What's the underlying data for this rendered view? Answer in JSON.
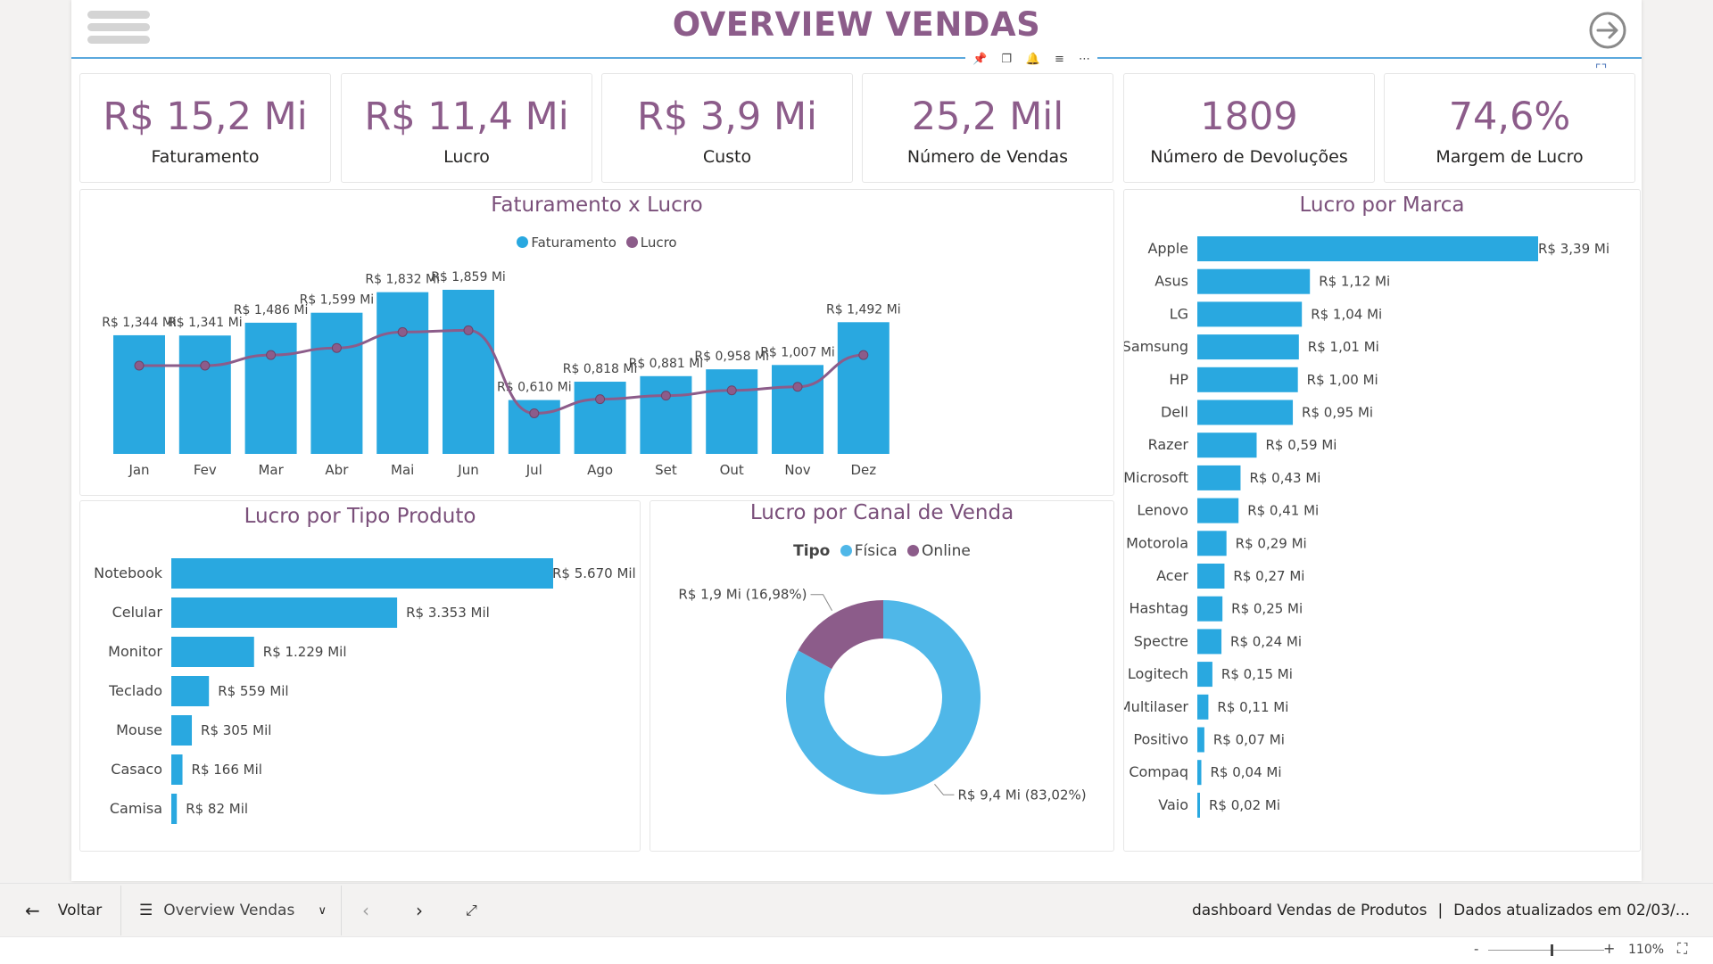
{
  "header": {
    "title": "OVERVIEW VENDAS"
  },
  "visual_toolbar": {
    "icons": [
      "pin-icon",
      "copy-icon",
      "bell-icon",
      "filter-icon",
      "more-options-icon"
    ]
  },
  "kpis": [
    {
      "value": "R$ 15,2 Mi",
      "label": "Faturamento"
    },
    {
      "value": "R$ 11,4 Mi",
      "label": "Lucro"
    },
    {
      "value": "R$ 3,9 Mi",
      "label": "Custo"
    },
    {
      "value": "25,2 Mil",
      "label": "Número de Vendas"
    },
    {
      "value": "1809",
      "label": "Número de Devoluções"
    },
    {
      "value": "74,6%",
      "label": "Margem de Lucro"
    }
  ],
  "colors": {
    "accent_blue": "#29a8e0",
    "accent_purple": "#8c5c8a",
    "donut_blue": "#4fb7e8"
  },
  "chart_data": [
    {
      "type": "bar",
      "title": "Faturamento x Lucro",
      "legend": [
        "Faturamento",
        "Lucro"
      ],
      "legend_position": "top-center",
      "categories": [
        "Jan",
        "Fev",
        "Mar",
        "Abr",
        "Mai",
        "Jun",
        "Jul",
        "Ago",
        "Set",
        "Out",
        "Nov",
        "Dez"
      ],
      "series": [
        {
          "name": "Faturamento",
          "type": "bar",
          "values": [
            1.344,
            1.341,
            1.486,
            1.599,
            1.832,
            1.859,
            0.61,
            0.818,
            0.881,
            0.958,
            1.007,
            1.492
          ]
        },
        {
          "name": "Lucro",
          "type": "line",
          "values": [
            1.0,
            1.0,
            1.12,
            1.2,
            1.38,
            1.4,
            0.46,
            0.62,
            0.66,
            0.72,
            0.76,
            1.12
          ]
        }
      ],
      "data_labels": [
        "R$ 1,344 Mi",
        "R$ 1,341 Mi",
        "R$ 1,486 Mi",
        "R$ 1,599 Mi",
        "R$ 1,832 Mi",
        "R$ 1,859 Mi",
        "R$ 0,610 Mi",
        "R$ 0,818 Mi",
        "R$ 0,881 Mi",
        "R$ 0,958 Mi",
        "R$ 1,007 Mi",
        "R$ 1,492 Mi"
      ],
      "ylim": [
        0,
        2.0
      ],
      "grid": false
    },
    {
      "type": "bar",
      "orientation": "horizontal",
      "title": "Lucro por Tipo Produto",
      "categories": [
        "Notebook",
        "Celular",
        "Monitor",
        "Teclado",
        "Mouse",
        "Casaco",
        "Camisa"
      ],
      "values": [
        5670,
        3353,
        1229,
        559,
        305,
        166,
        82
      ],
      "data_labels": [
        "R$ 5.670 Mil",
        "R$ 3.353 Mil",
        "R$ 1.229 Mil",
        "R$ 559 Mil",
        "R$ 305 Mil",
        "R$ 166 Mil",
        "R$ 82 Mil"
      ],
      "xlim": [
        0,
        5670
      ]
    },
    {
      "type": "pie",
      "donut": true,
      "title": "Lucro por Canal de Venda",
      "legend_title": "Tipo",
      "legend_position": "top-center",
      "categories": [
        "Física",
        "Online"
      ],
      "values": [
        83.02,
        16.98
      ],
      "data_labels": [
        "R$ 9,4 Mi (83,02%)",
        "R$ 1,9 Mi (16,98%)"
      ]
    },
    {
      "type": "bar",
      "orientation": "horizontal",
      "title": "Lucro por Marca",
      "categories": [
        "Apple",
        "Asus",
        "LG",
        "Samsung",
        "HP",
        "Dell",
        "Razer",
        "Microsoft",
        "Lenovo",
        "Motorola",
        "Acer",
        "Hashtag",
        "Spectre",
        "Logitech",
        "Multilaser",
        "Positivo",
        "Compaq",
        "Vaio"
      ],
      "values": [
        3.39,
        1.12,
        1.04,
        1.01,
        1.0,
        0.95,
        0.59,
        0.43,
        0.41,
        0.29,
        0.27,
        0.25,
        0.24,
        0.15,
        0.11,
        0.07,
        0.04,
        0.02
      ],
      "data_labels": [
        "R$ 3,39 Mi",
        "R$ 1,12 Mi",
        "R$ 1,04 Mi",
        "R$ 1,01 Mi",
        "R$ 1,00 Mi",
        "R$ 0,95 Mi",
        "R$ 0,59 Mi",
        "R$ 0,43 Mi",
        "R$ 0,41 Mi",
        "R$ 0,29 Mi",
        "R$ 0,27 Mi",
        "R$ 0,25 Mi",
        "R$ 0,24 Mi",
        "R$ 0,15 Mi",
        "R$ 0,11 Mi",
        "R$ 0,07 Mi",
        "R$ 0,04 Mi",
        "R$ 0,02 Mi"
      ],
      "xlim": [
        0,
        3.39
      ]
    }
  ],
  "footer": {
    "back_label": "Voltar",
    "page_selector_label": "Overview Vendas",
    "report_name": "dashboard Vendas de Produtos",
    "separator": "|",
    "updated_text": "Dados atualizados em 02/03/...",
    "zoom_minus": "-",
    "zoom_plus": "+",
    "zoom_level": "110%",
    "zoom_fraction": 0.55
  }
}
